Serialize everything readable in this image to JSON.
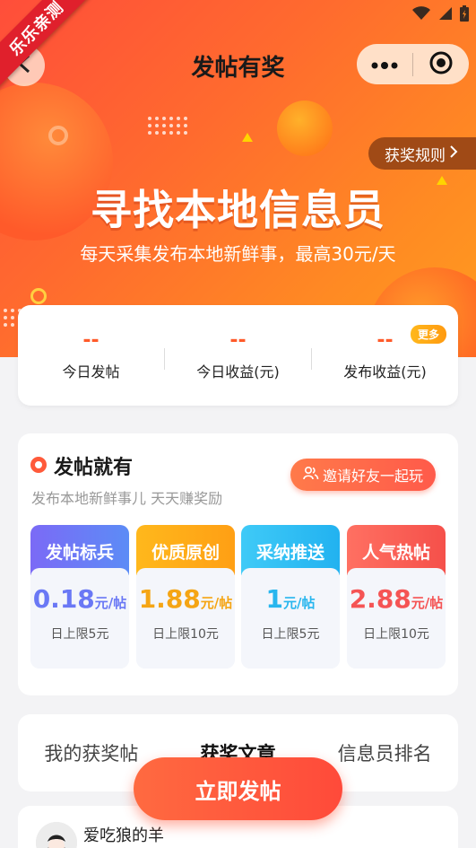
{
  "ribbon": {
    "label": "乐乐亲测"
  },
  "nav": {
    "title": "发帖有奖"
  },
  "hero": {
    "rules_label": "获奖规则",
    "title": "寻找本地信息员",
    "subtitle": "每天采集发布本地新鲜事，最高30元/天"
  },
  "stats": {
    "more_label": "更多",
    "items": [
      {
        "value": "--",
        "label": "今日发帖"
      },
      {
        "value": "--",
        "label": "今日收益(元)"
      },
      {
        "value": "--",
        "label": "发布收益(元)"
      }
    ]
  },
  "reward": {
    "title": "发帖就有",
    "subtitle": "发布本地新鲜事儿 天天赚奖励",
    "invite_label": "邀请好友一起玩",
    "tiles": [
      {
        "title": "发帖标兵",
        "amount": "0.18",
        "unit": "元/帖",
        "limit": "日上限5元",
        "color": "#6a78f5",
        "head": "linear-gradient(90deg,#7b6af6,#5c8cf6)"
      },
      {
        "title": "优质原创",
        "amount": "1.88",
        "unit": "元/帖",
        "limit": "日上限10元",
        "color": "#f5a514",
        "head": "linear-gradient(90deg,#ffb81c,#ff9f14)"
      },
      {
        "title": "采纳推送",
        "amount": "1",
        "unit": "元/帖",
        "limit": "日上限5元",
        "color": "#28b6ee",
        "head": "linear-gradient(90deg,#3fcaf7,#22b2f0)"
      },
      {
        "title": "人气热帖",
        "amount": "2.88",
        "unit": "元/帖",
        "limit": "日上限10元",
        "color": "#f55454",
        "head": "linear-gradient(90deg,#ff7062,#f5504a)"
      }
    ]
  },
  "tabs": [
    {
      "label": "我的获奖帖"
    },
    {
      "label": "获奖文章"
    },
    {
      "label": "信息员排名"
    }
  ],
  "post_button": {
    "label": "立即发帖"
  },
  "list": {
    "first_user": "爱吃狼的羊"
  }
}
